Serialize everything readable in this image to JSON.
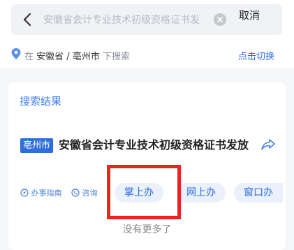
{
  "search": {
    "query": "安徽省会计专业技术初级资格证书发",
    "cancel_label": "取消"
  },
  "location": {
    "prefix": "在",
    "province": "安徽省",
    "separator": " / ",
    "city": "亳州市",
    "suffix": "下搜索",
    "switch_label": "点击切换"
  },
  "results": {
    "section_title": "搜索结果",
    "item": {
      "city_tag": "亳州市",
      "title": "安徽省会计专业技术初级资格证书发放",
      "guide_label": "办事指南",
      "consult_label": "咨询",
      "actions": [
        "掌上办",
        "网上办",
        "窗口办"
      ]
    },
    "no_more": "没有更多了"
  },
  "colors": {
    "accent": "#2f6ce0",
    "highlight": "#e8251f",
    "tag_bg": "#2d6ddc"
  }
}
